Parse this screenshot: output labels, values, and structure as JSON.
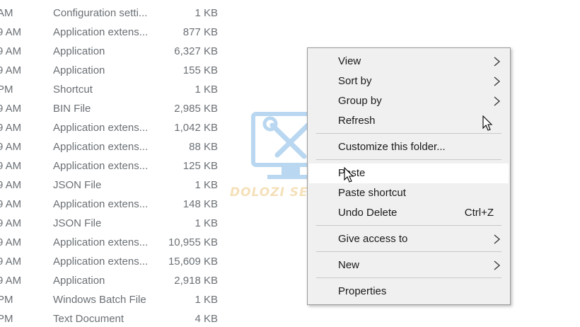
{
  "file_rows": [
    {
      "time": "AM",
      "type": "Configuration setti...",
      "size": "1 KB"
    },
    {
      "time": "9 AM",
      "type": "Application extens...",
      "size": "877 KB"
    },
    {
      "time": "9 AM",
      "type": "Application",
      "size": "6,327 KB"
    },
    {
      "time": "9 AM",
      "type": "Application",
      "size": "155 KB"
    },
    {
      "time": "PM",
      "type": "Shortcut",
      "size": "1 KB"
    },
    {
      "time": "9 AM",
      "type": "BIN File",
      "size": "2,985 KB"
    },
    {
      "time": "9 AM",
      "type": "Application extens...",
      "size": "1,042 KB"
    },
    {
      "time": "9 AM",
      "type": "Application extens...",
      "size": "88 KB"
    },
    {
      "time": "9 AM",
      "type": "Application extens...",
      "size": "125 KB"
    },
    {
      "time": "9 AM",
      "type": "JSON File",
      "size": "1 KB"
    },
    {
      "time": "9 AM",
      "type": "Application extens...",
      "size": "148 KB"
    },
    {
      "time": "9 AM",
      "type": "JSON File",
      "size": "1 KB"
    },
    {
      "time": "9 AM",
      "type": "Application extens...",
      "size": "10,955 KB"
    },
    {
      "time": "9 AM",
      "type": "Application extens...",
      "size": "15,609 KB"
    },
    {
      "time": "9 AM",
      "type": "Application",
      "size": "2,918 KB"
    },
    {
      "time": "PM",
      "type": "Windows Batch File",
      "size": "1 KB"
    },
    {
      "time": "PM",
      "type": "Text Document",
      "size": "4 KB"
    }
  ],
  "watermark": {
    "text": "DOLOZI SEVICE"
  },
  "context_menu": {
    "view": "View",
    "sort_by": "Sort by",
    "group_by": "Group by",
    "refresh": "Refresh",
    "customize": "Customize this folder...",
    "paste": "Paste",
    "paste_shortcut": "Paste shortcut",
    "undo_delete": "Undo Delete",
    "undo_delete_shortcut": "Ctrl+Z",
    "give_access": "Give access to",
    "new": "New",
    "properties": "Properties",
    "hovered_item": "Paste"
  }
}
